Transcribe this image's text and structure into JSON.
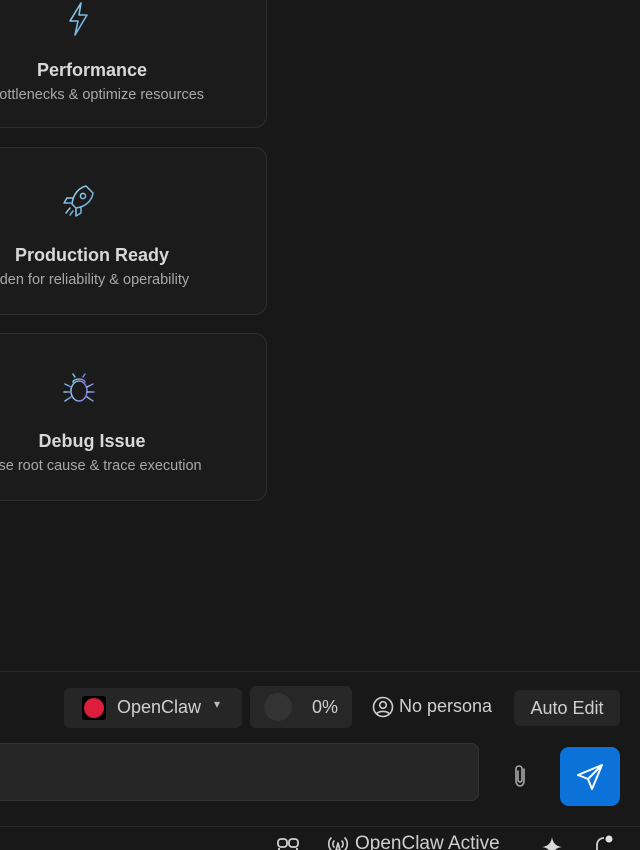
{
  "cards": [
    {
      "title": "Performance",
      "desc": "y bottlenecks & optimize resources",
      "icon": "lightning-icon"
    },
    {
      "title": "Production Ready",
      "desc": "rden for reliability & operability",
      "icon": "rocket-icon"
    },
    {
      "title": "Debug Issue",
      "desc": "nose root cause & trace execution",
      "icon": "bug-icon"
    }
  ],
  "toolbar": {
    "model_label": "OpenClaw",
    "model_icon": "openclaw-logo-icon",
    "model_color": "#dc1e3c",
    "context_percent": "0%",
    "persona_label": "No persona",
    "auto_edit_label": "Auto Edit"
  },
  "composer": {
    "input_value": "",
    "send_color": "#0a72d8"
  },
  "statusbar": {
    "status_text": "OpenClaw Active"
  }
}
